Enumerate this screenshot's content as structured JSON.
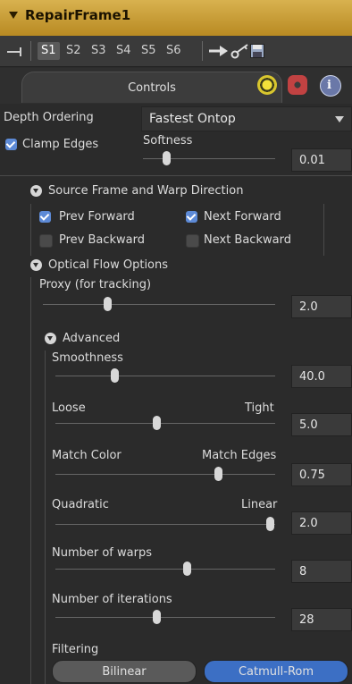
{
  "header": {
    "title": "RepairFrame1"
  },
  "toolbar": {
    "slots": [
      "S1",
      "S2",
      "S3",
      "S4",
      "S5",
      "S6"
    ],
    "active_slot": "S1"
  },
  "tabs": {
    "controls": "Controls"
  },
  "depth_ordering": {
    "label": "Depth Ordering",
    "value": "Fastest Ontop"
  },
  "clamp_edges": {
    "label": "Clamp Edges",
    "checked": true
  },
  "softness": {
    "label": "Softness",
    "value": "0.01",
    "level": 0.05
  },
  "source_section": {
    "title": "Source Frame and Warp Direction"
  },
  "checks": {
    "prev_forward": {
      "label": "Prev Forward",
      "checked": true
    },
    "next_forward": {
      "label": "Next Forward",
      "checked": true
    },
    "prev_backward": {
      "label": "Prev Backward",
      "checked": false
    },
    "next_backward": {
      "label": "Next Backward",
      "checked": false
    }
  },
  "optical_section": {
    "title": "Optical Flow Options"
  },
  "proxy": {
    "label": "Proxy (for tracking)",
    "value": "2.0"
  },
  "advanced": {
    "title": "Advanced"
  },
  "smoothness": {
    "label": "Smoothness",
    "value": "40.0"
  },
  "loose_tight": {
    "left": "Loose",
    "right": "Tight",
    "value": "5.0"
  },
  "match": {
    "left": "Match Color",
    "right": "Match Edges",
    "value": "0.75"
  },
  "quad_linear": {
    "left": "Quadratic",
    "right": "Linear",
    "value": "2.0"
  },
  "warps": {
    "label": "Number of warps",
    "value": "8"
  },
  "iterations": {
    "label": "Number of iterations",
    "value": "28"
  },
  "filtering": {
    "label": "Filtering",
    "options": [
      "Bilinear",
      "Catmull-Rom"
    ],
    "selected": "Catmull-Rom"
  },
  "colors": {
    "header": "#c99c33",
    "accent": "#3c6fc4",
    "checkbox": "#5d8ad6"
  }
}
